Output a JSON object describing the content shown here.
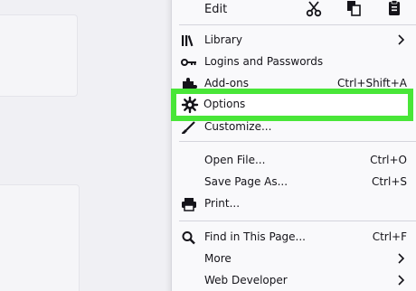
{
  "edit_row": {
    "label": "Edit",
    "buttons": [
      "cut-icon",
      "copy-icon",
      "paste-icon"
    ]
  },
  "menu": {
    "items": [
      {
        "label": "Library",
        "icon": "library-icon",
        "submenu": true
      },
      {
        "label": "Logins and Passwords",
        "icon": "key-icon"
      },
      {
        "label": "Add-ons",
        "icon": "puzzle-icon",
        "shortcut": "Ctrl+Shift+A"
      },
      {
        "label": "Options",
        "icon": "gear-icon",
        "highlighted": true
      },
      {
        "label": "Customize...",
        "icon": "paintbrush-icon"
      },
      {
        "label": "Open File...",
        "shortcut": "Ctrl+O"
      },
      {
        "label": "Save Page As...",
        "shortcut": "Ctrl+S"
      },
      {
        "label": "Print...",
        "icon": "printer-icon"
      },
      {
        "label": "Find in This Page...",
        "icon": "search-icon",
        "shortcut": "Ctrl+F"
      },
      {
        "label": "More",
        "submenu": true
      },
      {
        "label": "Web Developer",
        "submenu": true
      }
    ]
  },
  "colors": {
    "highlight_border": "#49e638",
    "menu_bg": "#f9f9fb",
    "page_bg": "#f0f0f4"
  }
}
